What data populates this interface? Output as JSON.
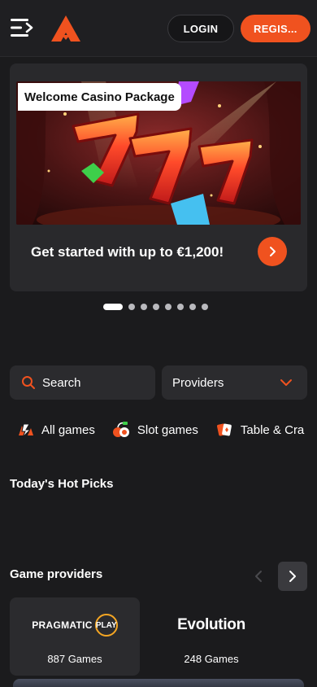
{
  "header": {
    "login_label": "LOGIN",
    "register_label": "REGIS..."
  },
  "banner": {
    "tag": "Welcome Casino Package",
    "text": "Get started with up to €1,200!",
    "slides_total": 8,
    "active_slide": 1
  },
  "search": {
    "label": "Search"
  },
  "providers_filter": {
    "label": "Providers"
  },
  "categories": [
    {
      "label": "All games",
      "icon": "all-games-icon"
    },
    {
      "label": "Slot games",
      "icon": "slot-machine-icon"
    },
    {
      "label": "Table & Cra",
      "icon": "cards-icon"
    }
  ],
  "sections": {
    "hot_picks_title": "Today's Hot Picks",
    "providers_title": "Game providers"
  },
  "providers": [
    {
      "name": "PRAGMATIC PLAY",
      "logo_text_left": "PRAGMATIC",
      "logo_text_right": "PLAY",
      "count": "887 Games"
    },
    {
      "name": "Evolution",
      "count": "248 Games"
    }
  ],
  "colors": {
    "accent": "#f0521f",
    "background": "#1b1b1d",
    "card": "#2b2b2e"
  }
}
